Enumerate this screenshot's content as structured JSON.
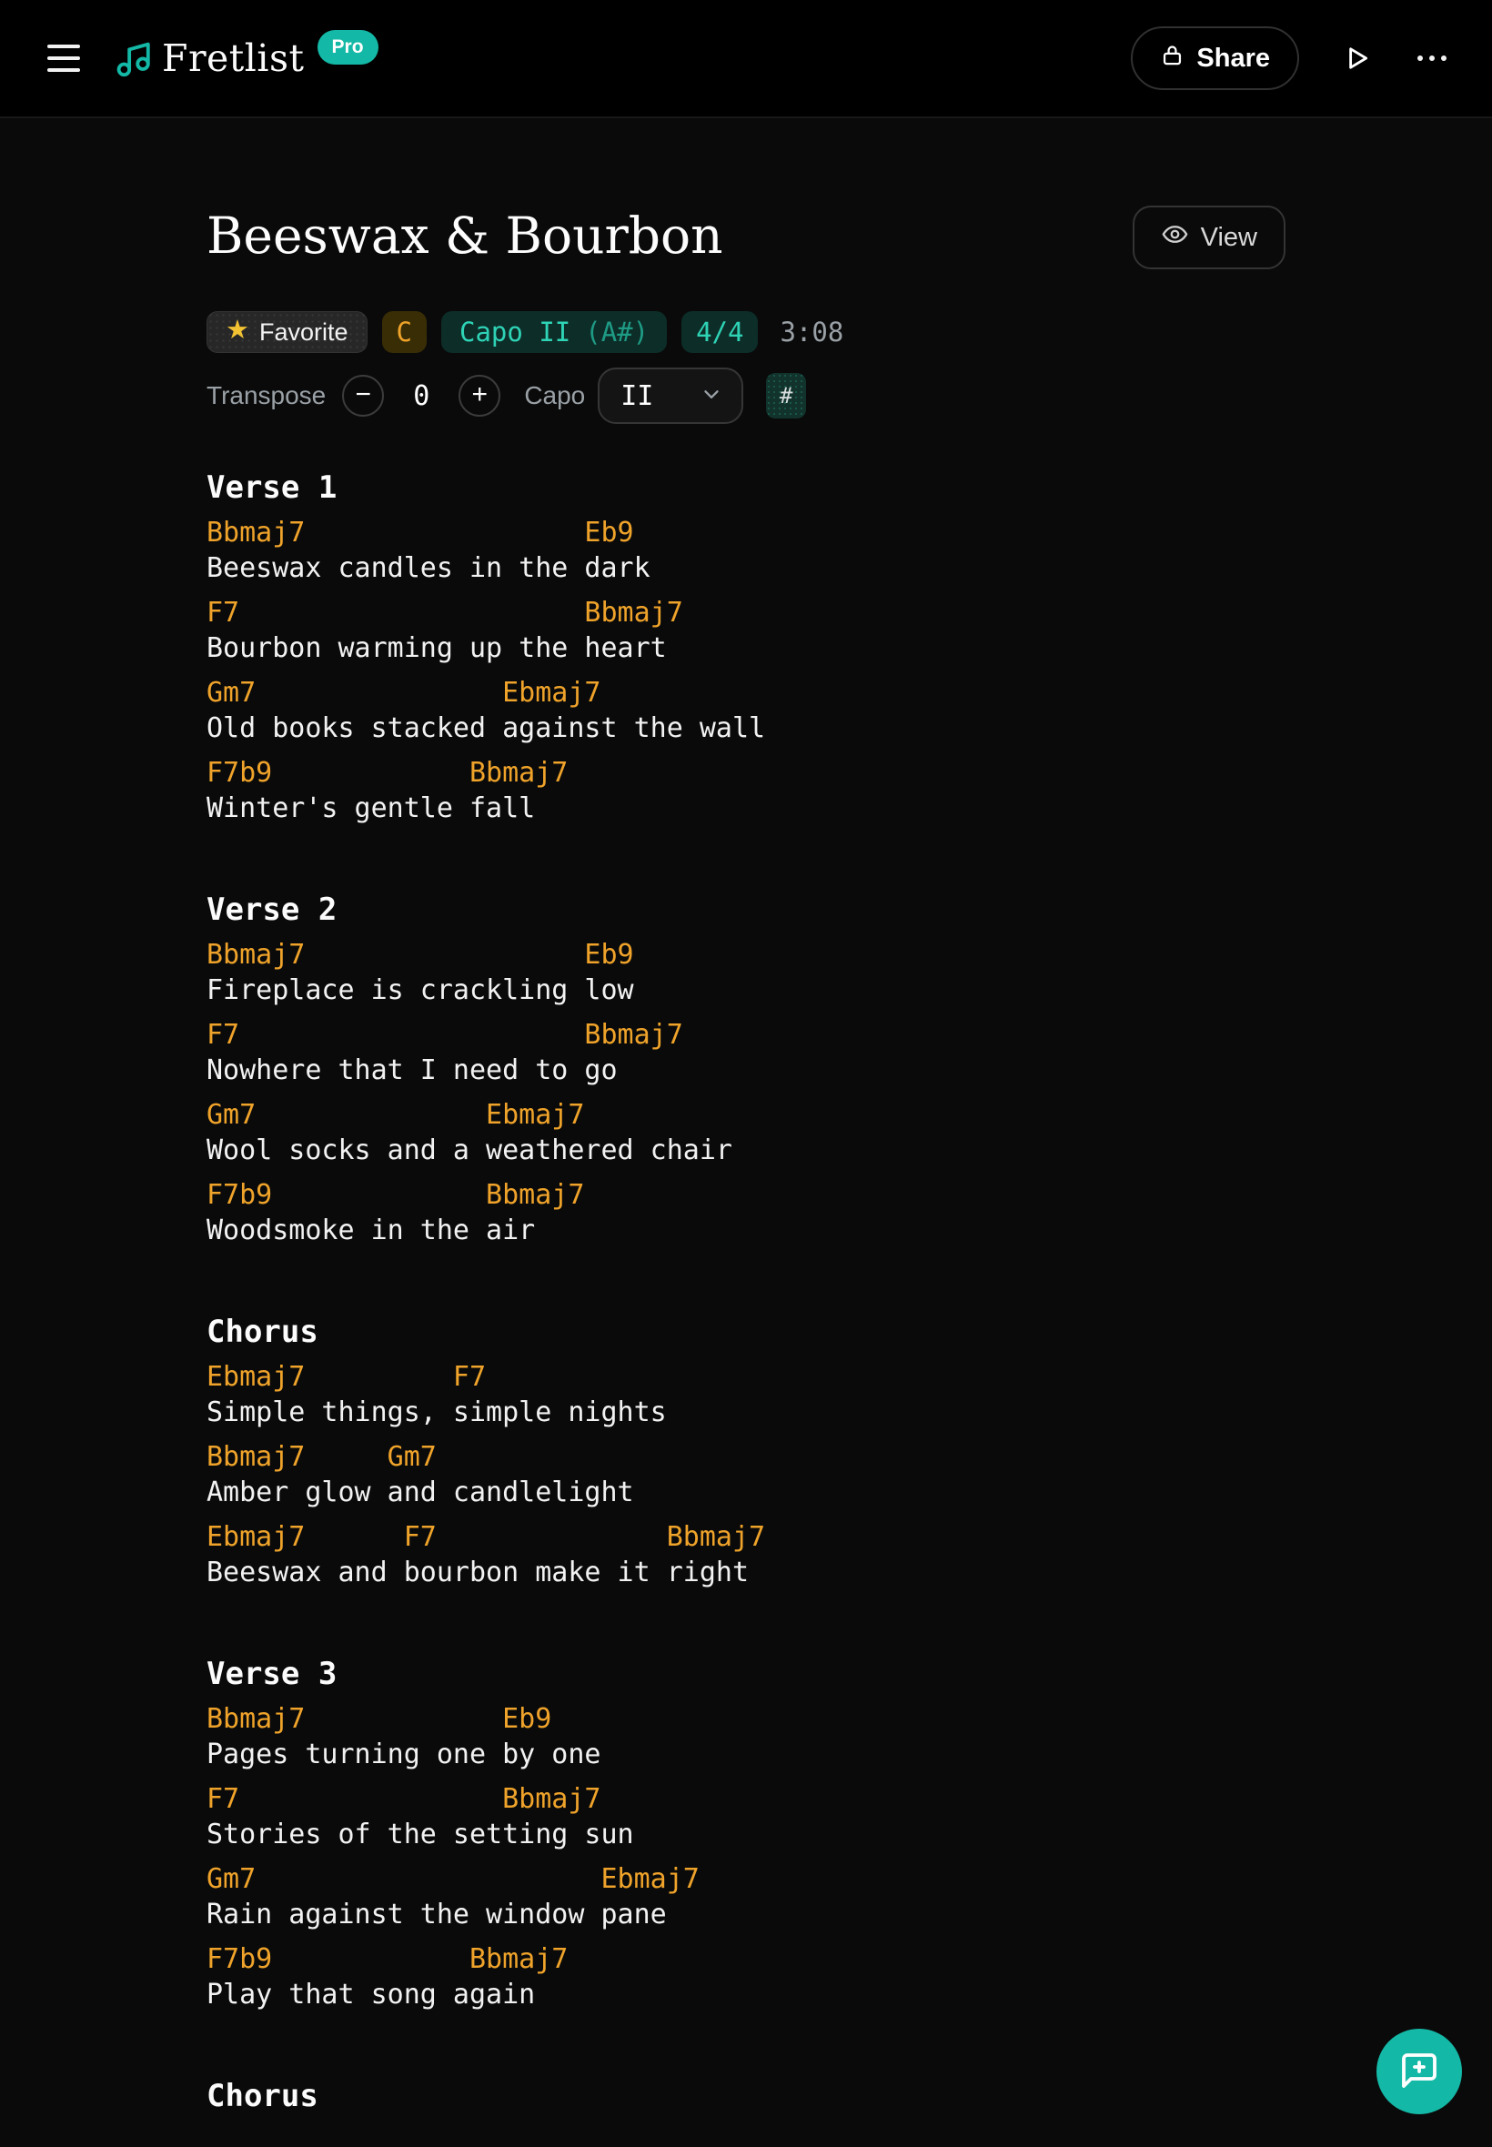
{
  "colors": {
    "accent_teal": "#14b8a6",
    "chord_amber": "#efa32a",
    "teal_badge_bg": "#0d2d28",
    "teal_badge_text": "#2ed3b6",
    "key_badge_bg": "#392d06",
    "key_badge_text": "#efa32a",
    "star_gold": "#f1c232",
    "muted_text": "#9aa1a6",
    "background": "#0a0a0a"
  },
  "header": {
    "app_name": "Fretlist",
    "pro_badge": "Pro",
    "share_label": "Share"
  },
  "song": {
    "title": "Beeswax & Bourbon",
    "view_label": "View",
    "badges": {
      "favorite_label": "Favorite",
      "star_glyph": "★",
      "key": "C",
      "capo_main": "Capo II",
      "capo_paren": "(A#)",
      "time_signature": "4/4",
      "duration": "3:08"
    }
  },
  "controls": {
    "transpose_label": "Transpose",
    "minus_glyph": "−",
    "transpose_value": "0",
    "plus_glyph": "+",
    "capo_label": "Capo",
    "capo_value": "II",
    "sharp_glyph": "#"
  },
  "sections": [
    {
      "name": "Verse 1",
      "lines": [
        {
          "chords": "Bbmaj7                 Eb9",
          "lyrics": "Beeswax candles in the dark"
        },
        {
          "chords": "F7                     Bbmaj7",
          "lyrics": "Bourbon warming up the heart"
        },
        {
          "chords": "Gm7               Ebmaj7",
          "lyrics": "Old books stacked against the wall"
        },
        {
          "chords": "F7b9            Bbmaj7",
          "lyrics": "Winter's gentle fall"
        }
      ]
    },
    {
      "name": "Verse 2",
      "lines": [
        {
          "chords": "Bbmaj7                 Eb9",
          "lyrics": "Fireplace is crackling low"
        },
        {
          "chords": "F7                     Bbmaj7",
          "lyrics": "Nowhere that I need to go"
        },
        {
          "chords": "Gm7              Ebmaj7",
          "lyrics": "Wool socks and a weathered chair"
        },
        {
          "chords": "F7b9             Bbmaj7",
          "lyrics": "Woodsmoke in the air"
        }
      ]
    },
    {
      "name": "Chorus",
      "lines": [
        {
          "chords": "Ebmaj7         F7",
          "lyrics": "Simple things, simple nights"
        },
        {
          "chords": "Bbmaj7     Gm7",
          "lyrics": "Amber glow and candlelight"
        },
        {
          "chords": "Ebmaj7      F7              Bbmaj7",
          "lyrics": "Beeswax and bourbon make it right"
        }
      ]
    },
    {
      "name": "Verse 3",
      "lines": [
        {
          "chords": "Bbmaj7            Eb9",
          "lyrics": "Pages turning one by one"
        },
        {
          "chords": "F7                Bbmaj7",
          "lyrics": "Stories of the setting sun"
        },
        {
          "chords": "Gm7                     Ebmaj7",
          "lyrics": "Rain against the window pane"
        },
        {
          "chords": "F7b9            Bbmaj7",
          "lyrics": "Play that song again"
        }
      ]
    },
    {
      "name": "Chorus",
      "lines": []
    }
  ]
}
